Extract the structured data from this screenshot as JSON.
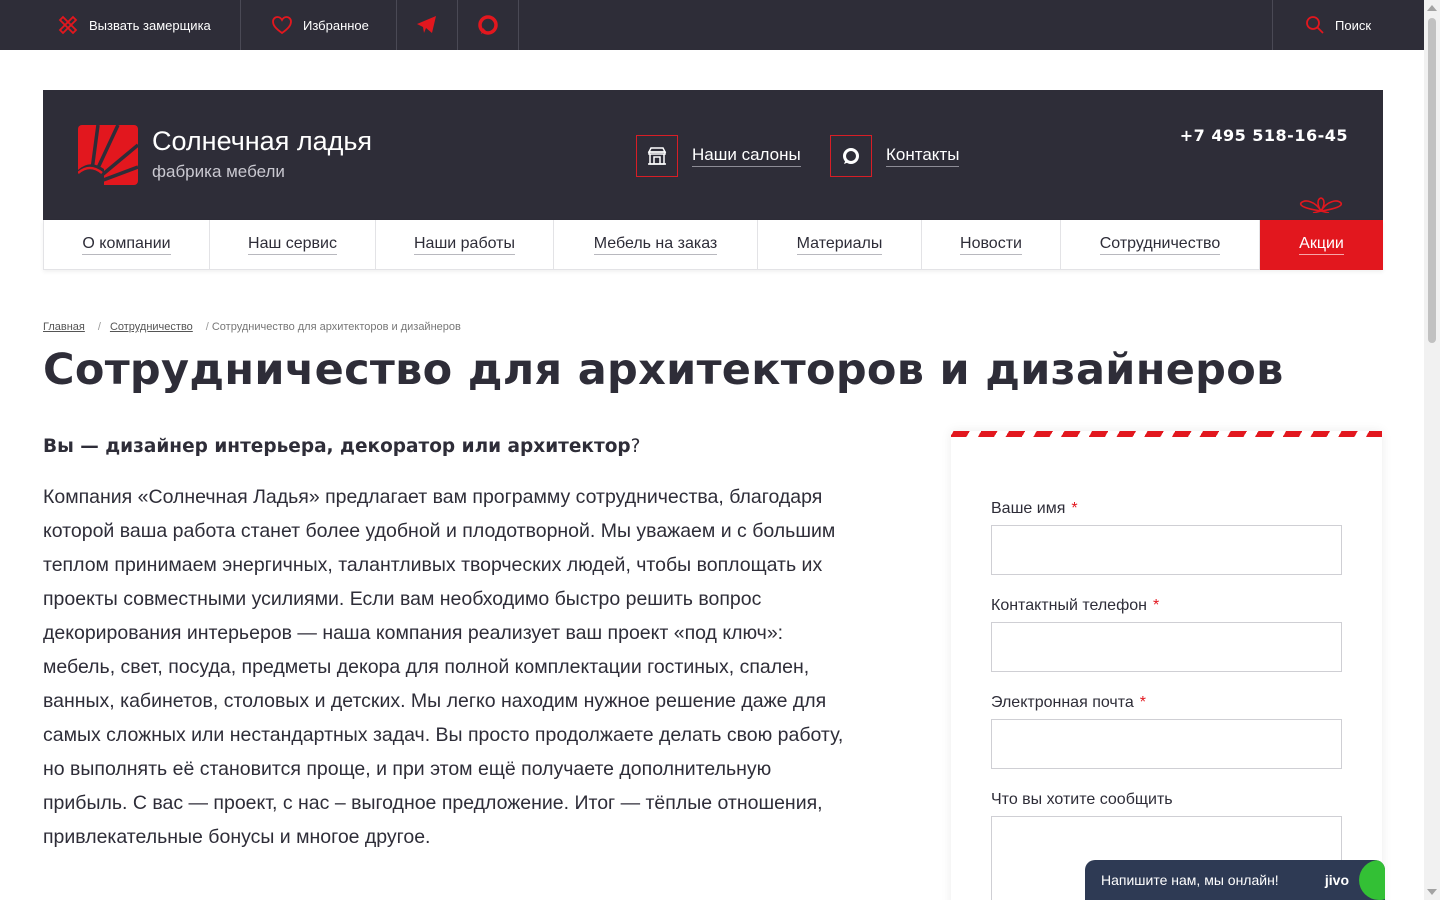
{
  "topbar": {
    "measure_label": "Вызвать замерщика",
    "favorites_label": "Избранное",
    "search_label": "Поиск"
  },
  "header": {
    "brand_name": "Солнечная ладья",
    "brand_sub": "фабрика мебели",
    "salons_label": "Наши салоны",
    "contacts_label": "Контакты",
    "phone": "+7 495 518-16-45"
  },
  "nav": {
    "items": [
      {
        "label": "О компании"
      },
      {
        "label": "Наш сервис"
      },
      {
        "label": "Наши работы"
      },
      {
        "label": "Мебель на заказ"
      },
      {
        "label": "Материалы"
      },
      {
        "label": "Новости"
      },
      {
        "label": "Сотрудничество"
      },
      {
        "label": "Акции"
      }
    ]
  },
  "breadcrumb": {
    "home": "Главная",
    "section": "Сотрудничество",
    "current": "Сотрудничество для архитекторов и дизайнеров"
  },
  "page": {
    "title": "Сотрудничество для архитекторов и дизайнеров",
    "lead_bold": "Вы — дизайнер интерьера, декоратор или архитектор",
    "lead_tail": "?",
    "body": "Компания «Солнечная Ладья» предлагает вам программу сотрудничества, благодаря которой ваша работа станет более удобной и плодотворной. Мы уважаем и с большим теплом принимаем энергичных, талантливых творческих людей, чтобы воплощать их проекты совместными усилиями. Если вам необходимо быстро решить вопрос декорирования интерьеров — наша компания реализует ваш проект «под ключ»: мебель, свет, посуда, предметы декора для полной комплектации гостиных, спален, ванных, кабинетов, столовых и детских.  Мы легко находим нужное решение даже для самых сложных или нестандартных задач. Вы просто продолжаете делать свою работу, но выполнять её становится проще, и при этом ещё получаете дополнительную прибыль. С вас — проект, с нас – выгодное предложение. Итог — тёплые отношения, привлекательные бонусы и многое другое."
  },
  "form": {
    "name_label": "Ваше имя",
    "phone_label": "Контактный телефон",
    "email_label": "Электронная почта",
    "message_label": "Что вы хотите сообщить",
    "required_mark": "*",
    "name_value": "",
    "phone_value": "",
    "email_value": ""
  },
  "chat": {
    "label": "Напишите нам, мы онлайн!",
    "brand": "jivo"
  },
  "colors": {
    "accent": "#e2171e",
    "dark": "#2e2d38",
    "chat_bg": "#2e3a54",
    "online": "#33c035"
  },
  "icons": {
    "measure": "ruler-cross-icon",
    "favorites": "heart-icon",
    "telegram": "telegram-icon",
    "chat": "chat-bubble-icon",
    "search": "search-icon",
    "salons": "storefront-icon",
    "contacts": "contact-bubble-icon",
    "gift": "gift-bow-icon"
  }
}
